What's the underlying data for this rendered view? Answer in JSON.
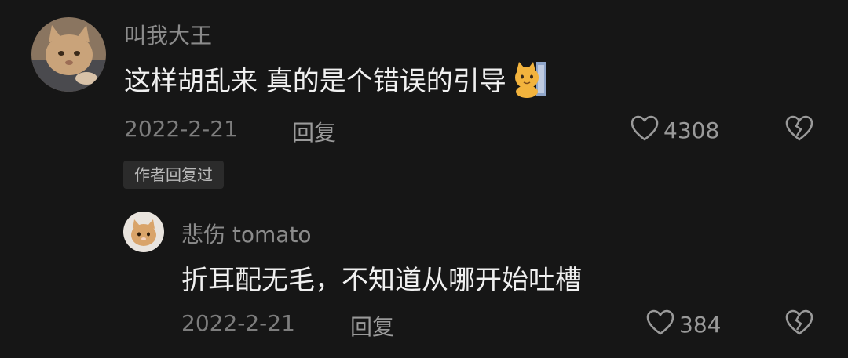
{
  "comment": {
    "username": "叫我大王",
    "text": "这样胡乱来 真的是个错误的引导",
    "emoji": "cat-emoji",
    "date": "2022-2-21",
    "reply_label": "回复",
    "like_count": "4308",
    "author_badge": "作者回复过"
  },
  "reply": {
    "username": "悲伤 tomato",
    "text": "折耳配无毛，不知道从哪开始吐槽",
    "date": "2022-2-21",
    "reply_label": "回复",
    "like_count": "384"
  },
  "colors": {
    "background": "#161616",
    "primary_text": "#f0f0f0",
    "secondary_text": "#8b8b8b",
    "badge_bg": "#2b2b2b"
  }
}
